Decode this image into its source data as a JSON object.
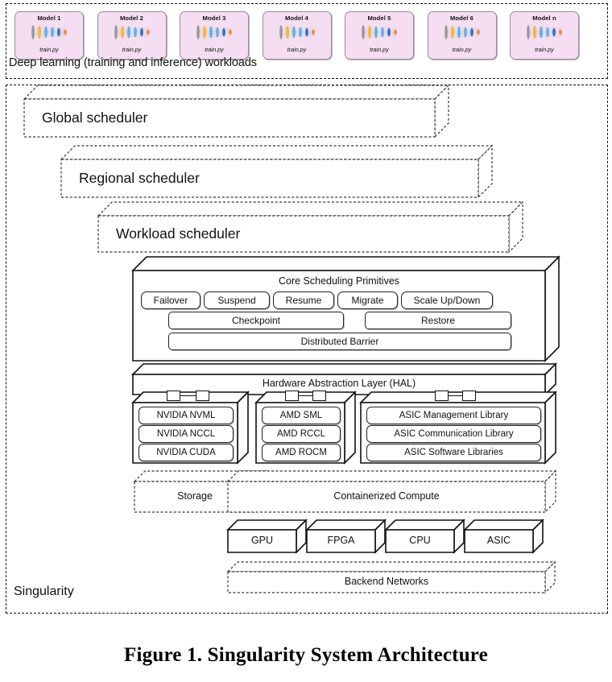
{
  "figure": {
    "caption": "Figure 1. Singularity System Architecture"
  },
  "workloads": {
    "label": "Deep learning (training and inference) workloads",
    "models": [
      {
        "title": "Model 1",
        "file": "train.py"
      },
      {
        "title": "Model 2",
        "file": "train.py"
      },
      {
        "title": "Model 3",
        "file": "train.py"
      },
      {
        "title": "Model 4",
        "file": "train.py"
      },
      {
        "title": "Model 5",
        "file": "train.py"
      },
      {
        "title": "Model 6",
        "file": "train.py"
      },
      {
        "title": "Model n",
        "file": "train.py"
      }
    ],
    "icon_colors": [
      "#9a9a9a",
      "#f5b731",
      "#5ab4e5",
      "#2f72c4",
      "#f08a3c"
    ]
  },
  "singularity": {
    "label": "Singularity",
    "schedulers": [
      {
        "label": "Global scheduler"
      },
      {
        "label": "Regional scheduler"
      },
      {
        "label": "Workload scheduler"
      }
    ],
    "core_primitives": {
      "title": "Core Scheduling Primitives",
      "row1": [
        "Failover",
        "Suspend",
        "Resume",
        "Migrate",
        "Scale Up/Down"
      ],
      "row2": [
        "Checkpoint",
        "Restore"
      ],
      "row3": [
        "Distributed Barrier"
      ]
    },
    "hal": {
      "title": "Hardware Abstraction Layer (HAL)"
    },
    "vendor_stacks": [
      {
        "name": "nvidia",
        "items": [
          "NVIDIA NVML",
          "NVIDIA NCCL",
          "NVIDIA CUDA"
        ]
      },
      {
        "name": "amd",
        "items": [
          "AMD SML",
          "AMD RCCL",
          "AMD ROCM"
        ]
      },
      {
        "name": "asic",
        "items": [
          "ASIC Management Library",
          "ASIC Communication Library",
          "ASIC Software Libraries"
        ]
      }
    ],
    "infrastructure": {
      "storage": "Storage",
      "compute": "Containerized Compute",
      "hardware": [
        "GPU",
        "FPGA",
        "CPU",
        "ASIC"
      ],
      "networks": "Backend Networks"
    }
  }
}
